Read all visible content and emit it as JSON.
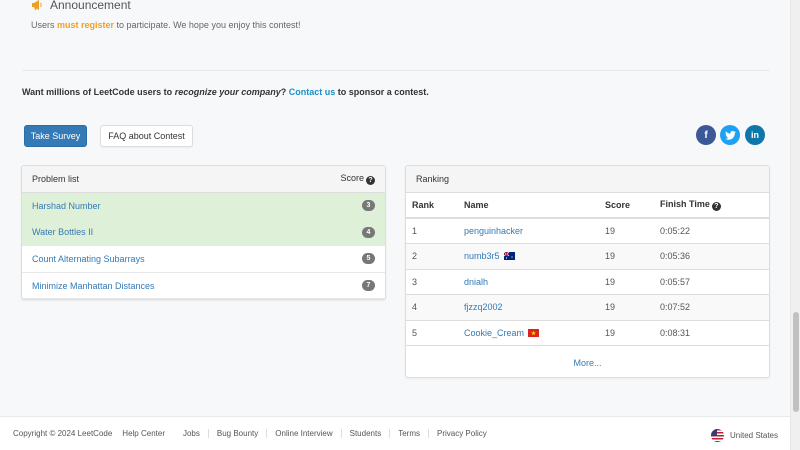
{
  "announcement": {
    "title": "Announcement",
    "text_before": "Users ",
    "link": "must register",
    "text_after": " to participate. We hope you enjoy this contest!"
  },
  "sponsor": {
    "prefix": "Want millions of LeetCode users to ",
    "emphasis": "recognize your company",
    "middle": "? ",
    "contact": "Contact us",
    "suffix": " to sponsor a contest."
  },
  "buttons": {
    "survey": "Take Survey",
    "faq": "FAQ about Contest"
  },
  "social": {
    "facebook": "f",
    "twitter": "t",
    "linkedin": "in"
  },
  "problem_list": {
    "title": "Problem list",
    "score_header": "Score",
    "problems": [
      {
        "name": "Harshad Number",
        "score": "3",
        "solved": true
      },
      {
        "name": "Water Bottles II",
        "score": "4",
        "solved": true
      },
      {
        "name": "Count Alternating Subarrays",
        "score": "5",
        "solved": false
      },
      {
        "name": "Minimize Manhattan Distances",
        "score": "7",
        "solved": false
      }
    ]
  },
  "ranking": {
    "title": "Ranking",
    "headers": {
      "rank": "Rank",
      "name": "Name",
      "score": "Score",
      "finish": "Finish Time"
    },
    "rows": [
      {
        "rank": "1",
        "name": "penguinhacker",
        "score": "19",
        "finish": "0:05:22",
        "flag": ""
      },
      {
        "rank": "2",
        "name": "numb3r5",
        "score": "19",
        "finish": "0:05:36",
        "flag": "australia-flag"
      },
      {
        "rank": "3",
        "name": "dnialh",
        "score": "19",
        "finish": "0:05:57",
        "flag": ""
      },
      {
        "rank": "4",
        "name": "fjzzq2002",
        "score": "19",
        "finish": "0:07:52",
        "flag": ""
      },
      {
        "rank": "5",
        "name": "Cookie_Cream",
        "score": "19",
        "finish": "0:08:31",
        "flag": "vietnam-flag"
      }
    ],
    "more": "More..."
  },
  "footer": {
    "copyright": "Copyright © 2024 LeetCode",
    "links": [
      "Help Center",
      "Jobs",
      "Bug Bounty",
      "Online Interview",
      "Students",
      "Terms",
      "Privacy Policy"
    ],
    "region": "United States"
  },
  "colors": {
    "primary": "#337ab7",
    "accent": "#f0a020",
    "solved_bg": "#dff0d8"
  }
}
